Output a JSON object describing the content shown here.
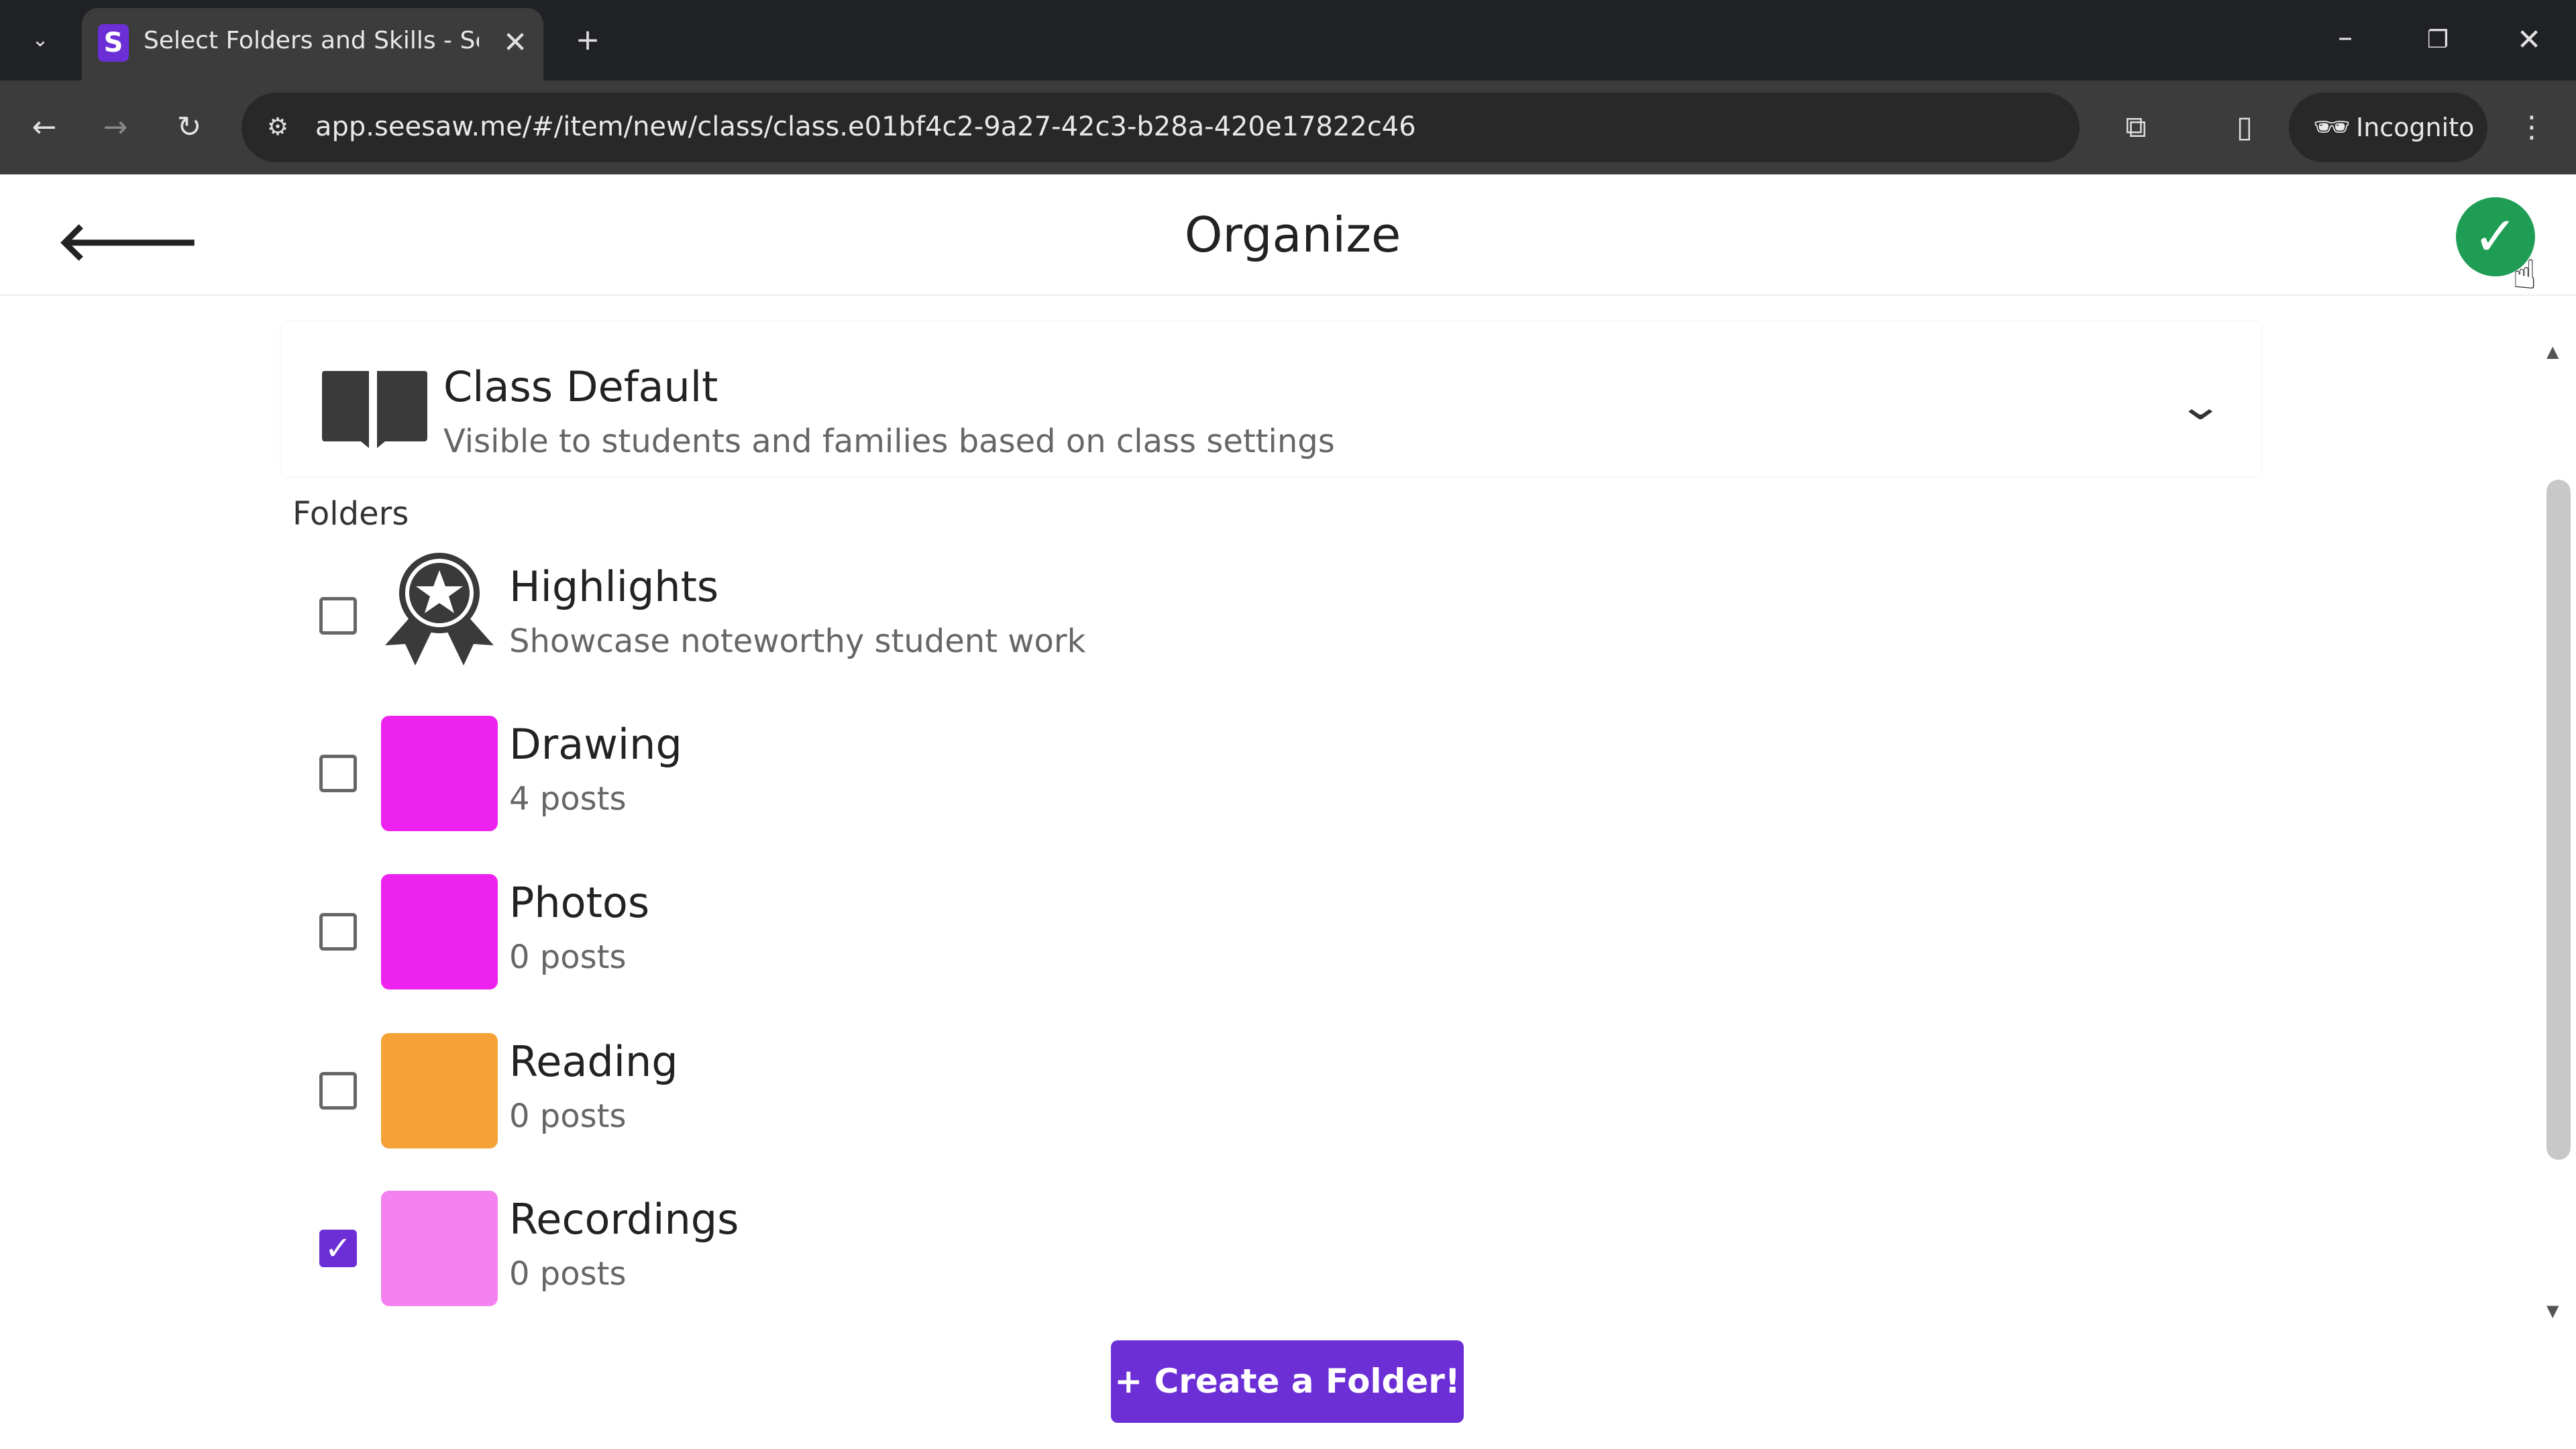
{
  "browser": {
    "tab_title": "Select Folders and Skills - Seesaw",
    "favicon_letter": "S",
    "url": "app.seesaw.me/#/item/new/class/class.e01bf4c2-9a27-42c3-b28a-420e17822c46",
    "incognito_label": "Incognito"
  },
  "header": {
    "title": "Organize"
  },
  "class_default": {
    "title": "Class Default",
    "subtitle": "Visible to students and families based on class settings"
  },
  "folders_label": "Folders",
  "folders": [
    {
      "name": "Highlights",
      "sub": "Showcase noteworthy student work",
      "checked": false,
      "icon": "award-ribbon-icon"
    },
    {
      "name": "Drawing",
      "sub": "4 posts",
      "checked": false,
      "color": "#ee22ee"
    },
    {
      "name": "Photos",
      "sub": "0 posts",
      "checked": false,
      "color": "#ee22ee"
    },
    {
      "name": "Reading",
      "sub": "0 posts",
      "checked": false,
      "color": "#f4a236"
    },
    {
      "name": "Recordings",
      "sub": "0 posts",
      "checked": true,
      "color": "#f382ef"
    }
  ],
  "create_button": "+ Create a Folder!",
  "colors": {
    "accent": "#6c2fd6",
    "done": "#1f9d55"
  }
}
